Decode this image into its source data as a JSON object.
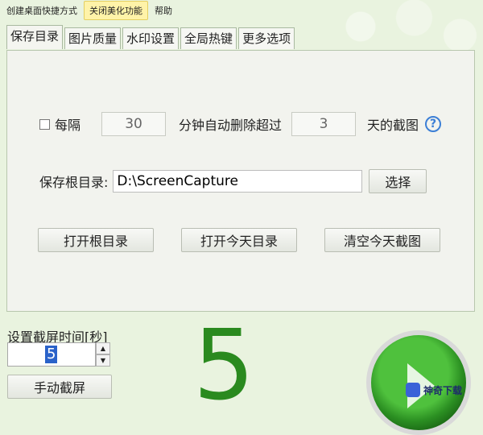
{
  "menu": [
    "创建桌面快捷方式",
    "关闭美化功能",
    "帮助"
  ],
  "tabs": [
    "保存目录",
    "图片质量",
    "水印设置",
    "全局热键",
    "更多选项"
  ],
  "auto_delete": {
    "label_every": "每隔",
    "minutes_value": "30",
    "label_minutes": "分钟自动删除超过",
    "days_value": "3",
    "label_days": "天的截图",
    "help_icon": "question-circle-icon"
  },
  "save_root": {
    "label": "保存根目录:",
    "path_value": "D:\\ScreenCapture",
    "choose_button": "选择"
  },
  "actions": {
    "open_root": "打开根目录",
    "open_today": "打开今天目录",
    "clear_today": "清空今天截图"
  },
  "timer": {
    "label": "设置截屏时间[秒]",
    "value": "5",
    "countdown": "5",
    "manual_button": "手动截屏"
  },
  "colors": {
    "accent_green": "#2a8a1f",
    "background": "#e9f3df",
    "selection_blue": "#2a62c9"
  },
  "watermark": {
    "text": "神奇下载"
  }
}
